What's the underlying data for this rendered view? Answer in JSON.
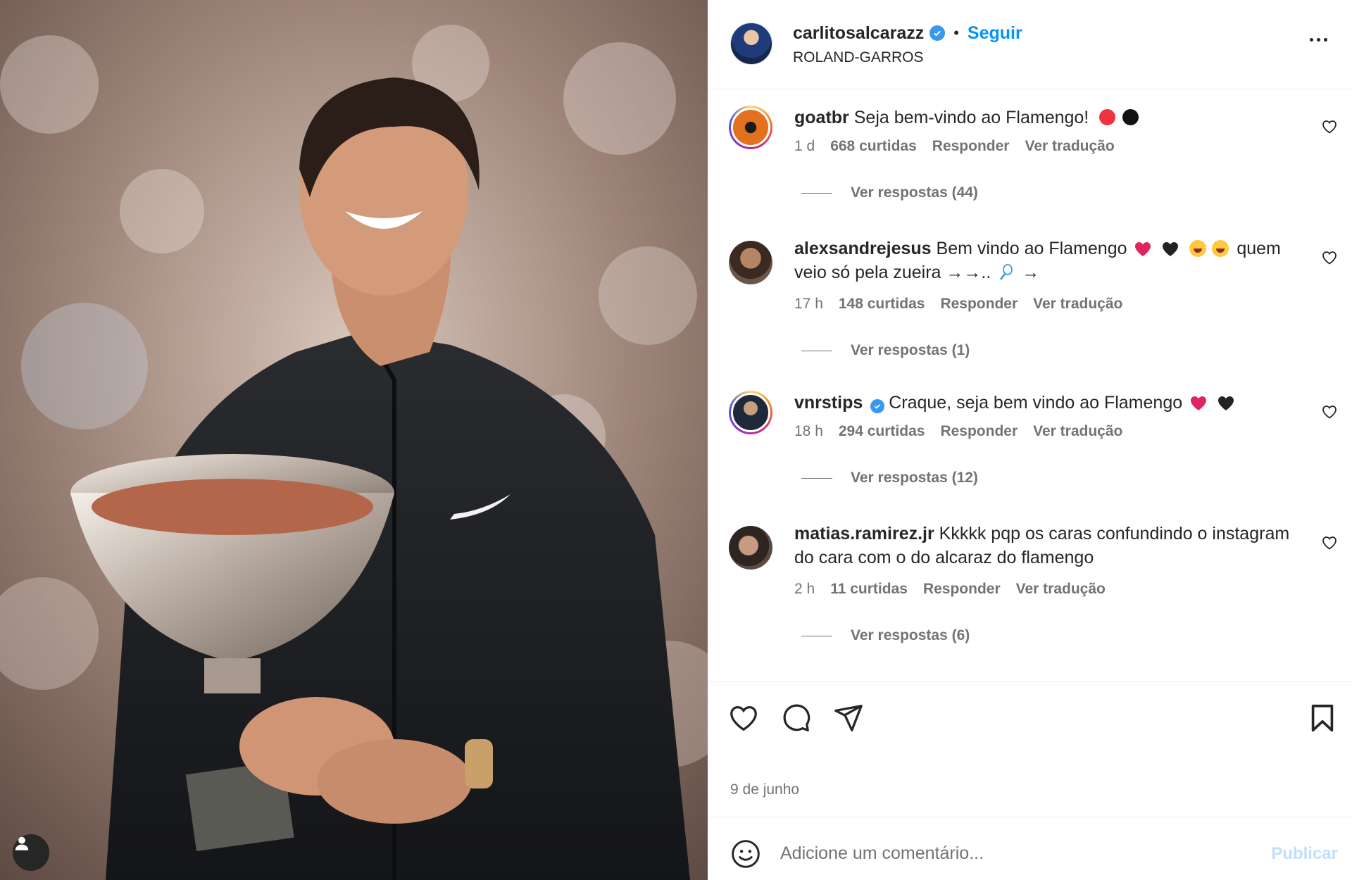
{
  "post": {
    "author": "carlitosalcarazz",
    "follow": "Seguir",
    "separator": "•",
    "location": "ROLAND-GARROS",
    "date": "9 de junho"
  },
  "comments": [
    {
      "user": "goatbr",
      "text": "Seja bem-vindo ao Flamengo!",
      "time": "1 d",
      "likes": "668 curtidas",
      "reply": "Responder",
      "translate": "Ver tradução",
      "replies": "Ver respostas (44)"
    },
    {
      "user": "alexsandrejesus",
      "text_a": "Bem vindo ao Flamengo",
      "text_b": "quem",
      "text_c": "veio só pela zueira →→..",
      "text_d": "→",
      "time": "17 h",
      "likes": "148 curtidas",
      "reply": "Responder",
      "translate": "Ver tradução",
      "replies": "Ver respostas (1)"
    },
    {
      "user": "vnrstips",
      "text": "Craque, seja bem vindo ao Flamengo",
      "time": "18 h",
      "likes": "294 curtidas",
      "reply": "Responder",
      "translate": "Ver tradução",
      "replies": "Ver respostas (12)"
    },
    {
      "user": "matias.ramirez.jr",
      "text": "Kkkkk pqp os caras confundindo o instagram do cara com o do alcaraz do flamengo",
      "time": "2 h",
      "likes": "11 curtidas",
      "reply": "Responder",
      "translate": "Ver tradução",
      "replies": "Ver respostas (6)"
    }
  ],
  "add_comment": {
    "placeholder": "Adicione um comentário...",
    "publish": "Publicar"
  },
  "colors": {
    "link_blue": "#0095f6",
    "verified_blue": "#3897f0",
    "muted_text": "#737373",
    "publish_disabled": "#c0dffd"
  },
  "icons": [
    "user-icon",
    "verified-icon",
    "more-icon",
    "heart-icon",
    "comment-icon",
    "share-icon",
    "bookmark-icon",
    "emoji-icon"
  ]
}
